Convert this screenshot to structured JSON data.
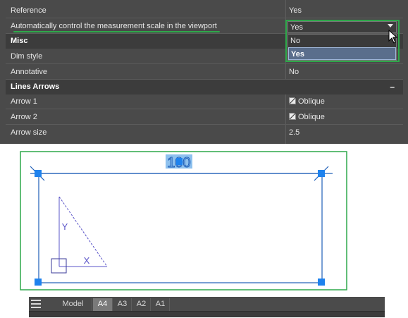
{
  "properties": {
    "rows": [
      {
        "key": "Reference",
        "value": "Yes"
      },
      {
        "key": "Automatically control the measurement scale in the viewport",
        "value": "Yes"
      }
    ],
    "misc_section": {
      "title": "Misc"
    },
    "misc_rows": [
      {
        "key": "Dim style",
        "value": ""
      },
      {
        "key": "Annotative",
        "value": "No"
      }
    ],
    "lines_section": {
      "title": "Lines  Arrows",
      "collapse": "–"
    },
    "lines_rows": [
      {
        "key": "Arrow 1",
        "value": "Oblique"
      },
      {
        "key": "Arrow 2",
        "value": "Oblique"
      },
      {
        "key": "Arrow size",
        "value": "2.5"
      }
    ],
    "combo": {
      "value": "Yes",
      "options": [
        "No",
        "Yes"
      ],
      "selected_option": "Yes"
    }
  },
  "drawing": {
    "dimension_text": "100",
    "ucs_y": "Y",
    "ucs_x": "X"
  },
  "layout_tabs": {
    "tabs": [
      "Model",
      "A4",
      "A3",
      "A2",
      "A1"
    ],
    "active": "A4"
  },
  "colors": {
    "highlight_green": "#2ea84a",
    "viewport_blue": "#1f5fb8",
    "grip_blue": "#1e82ee",
    "ucs_purple": "#5a54c8"
  }
}
